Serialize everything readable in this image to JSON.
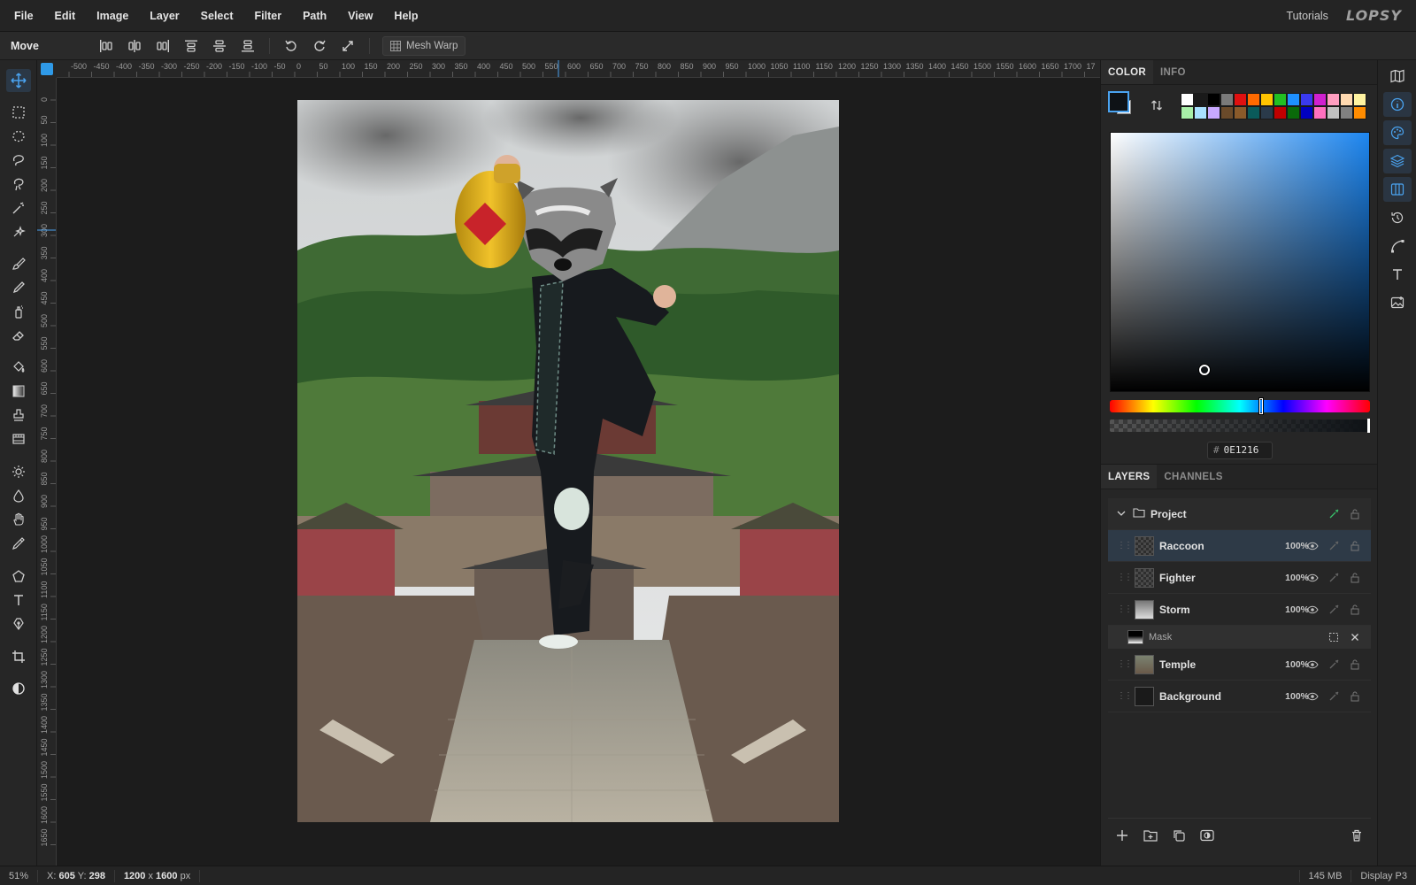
{
  "menubar": {
    "items": [
      "File",
      "Edit",
      "Image",
      "Layer",
      "Select",
      "Filter",
      "Path",
      "View",
      "Help"
    ],
    "tutorials": "Tutorials",
    "logo": "LOPSY"
  },
  "options": {
    "tool_name": "Move",
    "mesh_warp": "Mesh Warp"
  },
  "rulers": {
    "top_ticks": [
      "-500",
      "-450",
      "-400",
      "-350",
      "-300",
      "-250",
      "-200",
      "-150",
      "-100",
      "-50",
      "0",
      "50",
      "100",
      "150",
      "200",
      "250",
      "300",
      "350",
      "400",
      "450",
      "500",
      "550",
      "600",
      "650",
      "700",
      "750",
      "800",
      "850",
      "900",
      "950",
      "1000",
      "1050",
      "1100",
      "1150",
      "1200",
      "1250",
      "1300",
      "1350",
      "1400",
      "1450",
      "1500",
      "1550",
      "1600",
      "1650",
      "1700",
      "17"
    ],
    "left_ticks": [
      "0",
      "50",
      "100",
      "150",
      "200",
      "250",
      "300",
      "350",
      "400",
      "450",
      "500",
      "550",
      "600",
      "650",
      "700",
      "750",
      "800",
      "850",
      "900",
      "950",
      "1000",
      "1050",
      "1100",
      "1150",
      "1200",
      "1250",
      "1300",
      "1350",
      "1400",
      "1450",
      "1500",
      "1550",
      "1600",
      "1650"
    ]
  },
  "color_panel": {
    "tabs": [
      "COLOR",
      "INFO"
    ],
    "foreground": "#0E1216",
    "background": "#FFFFFF",
    "hex_label": "#",
    "hex_value": "0E1216",
    "hue_position": 0.58,
    "saturation": 0.36,
    "brightness": 0.09,
    "alpha": 1.0,
    "swatches": [
      "#ffffff",
      "#1a1a1a",
      "#000000",
      "#7a7a7a",
      "#e01010",
      "#ff6a00",
      "#ffc400",
      "#22c022",
      "#1e90ff",
      "#3a3af0",
      "#d020d0",
      "#ff9ec0",
      "#ffd9b0",
      "#fff3a0",
      "#a8f0a8",
      "#a8e0ff",
      "#c8a8ff",
      "#6a4a2a",
      "#8a5a2a",
      "#0a5a5a",
      "#2a3a4a",
      "#c00000",
      "#0a6a0a",
      "#0000c0",
      "#ff70c0",
      "#c0c0c0",
      "#808080",
      "#ff8c00"
    ]
  },
  "layers_panel": {
    "tabs": [
      "LAYERS",
      "CHANNELS"
    ],
    "group_name": "Project",
    "layers": [
      {
        "name": "Raccoon",
        "opacity": "100%"
      },
      {
        "name": "Fighter",
        "opacity": "100%"
      },
      {
        "name": "Storm",
        "opacity": "100%"
      },
      {
        "name": "Temple",
        "opacity": "100%"
      },
      {
        "name": "Background",
        "opacity": "100%"
      }
    ],
    "mask_name": "Mask"
  },
  "status": {
    "zoom": "51%",
    "x_label": "X:",
    "x_value": "605",
    "y_label": "Y:",
    "y_value": "298",
    "doc_w": "1200",
    "doc_x": "x",
    "doc_h": "1600",
    "doc_unit": "px",
    "memory": "145 MB",
    "profile": "Display P3"
  }
}
